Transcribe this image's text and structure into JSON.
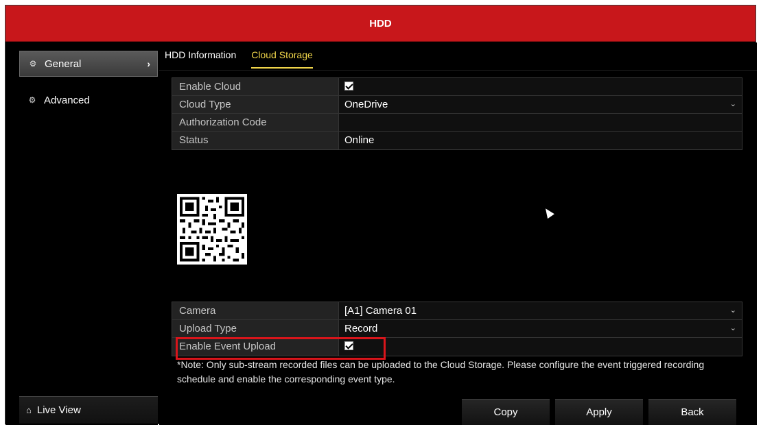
{
  "window": {
    "title": "HDD"
  },
  "sidebar": {
    "items": [
      {
        "label": "General",
        "icon": "gear-icon",
        "active": true
      },
      {
        "label": "Advanced",
        "icon": "gears-icon",
        "active": false
      }
    ],
    "live_view": {
      "label": "Live View",
      "icon": "home-icon"
    }
  },
  "tabs": [
    {
      "label": "HDD Information",
      "active": false
    },
    {
      "label": "Cloud Storage",
      "active": true
    }
  ],
  "cloud": {
    "enable_cloud": {
      "label": "Enable Cloud",
      "checked": true
    },
    "cloud_type": {
      "label": "Cloud Type",
      "value": "OneDrive"
    },
    "authorization_code": {
      "label": "Authorization Code",
      "value": ""
    },
    "status": {
      "label": "Status",
      "value": "Online"
    }
  },
  "upload": {
    "camera": {
      "label": "Camera",
      "value": "[A1] Camera 01"
    },
    "upload_type": {
      "label": "Upload Type",
      "value": "Record"
    },
    "enable_event_upload": {
      "label": "Enable Event Upload",
      "checked": true
    }
  },
  "note": "*Note: Only sub-stream recorded files can be uploaded to the Cloud Storage. Please configure the event triggered recording schedule and enable the corresponding event type.",
  "buttons": {
    "copy": "Copy",
    "apply": "Apply",
    "back": "Back"
  },
  "colors": {
    "titlebar": "#c8171b",
    "active_tab": "#f1d64a",
    "highlight": "#d9151b"
  }
}
